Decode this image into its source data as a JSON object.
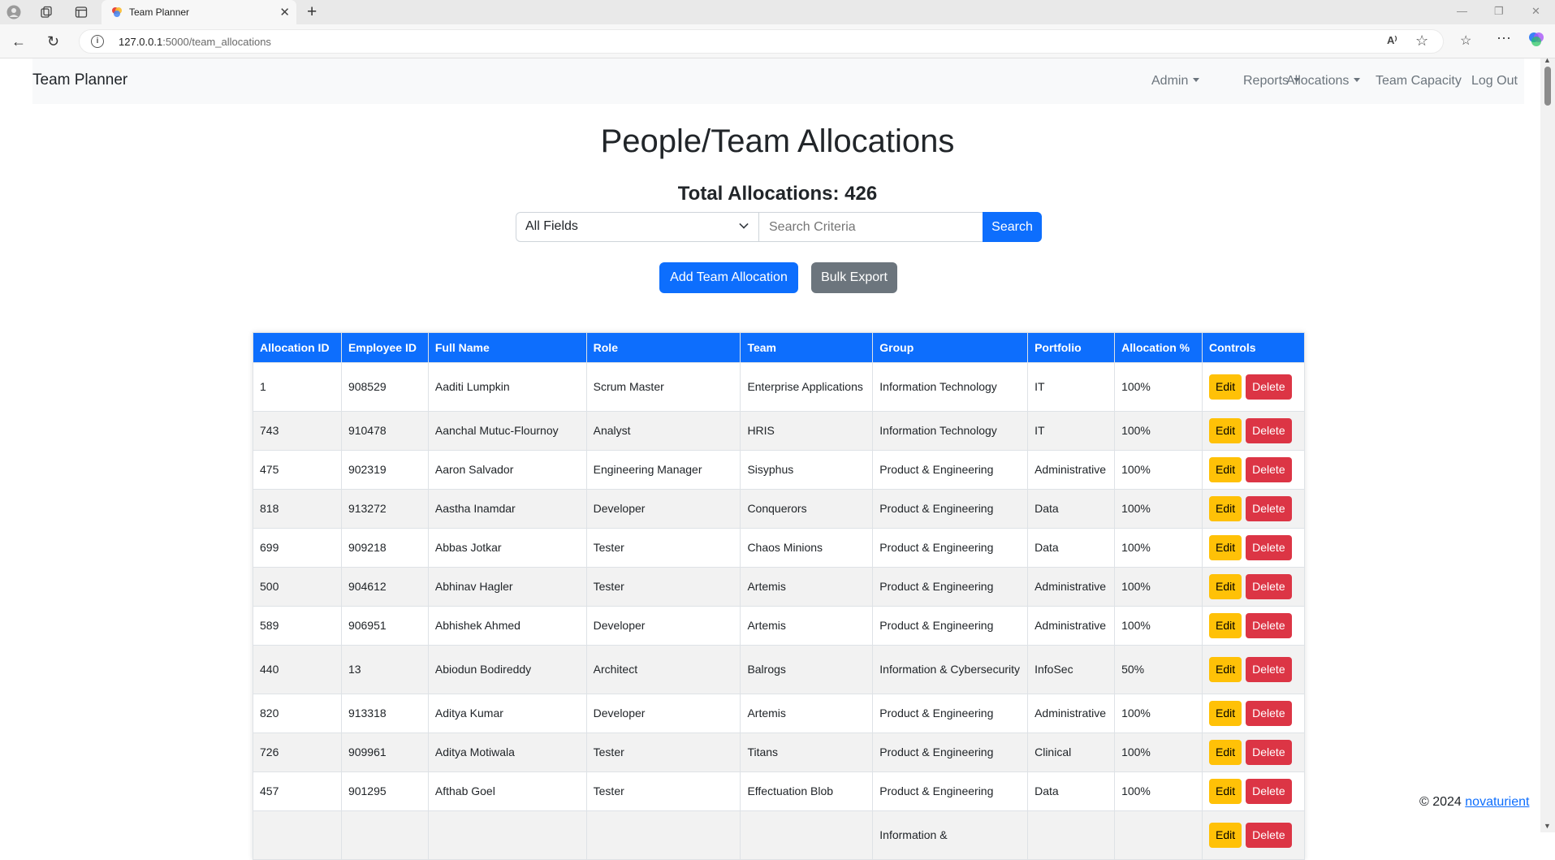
{
  "browser": {
    "tab_title": "Team Planner",
    "url_host": "127.0.0.1",
    "url_rest": ":5000/team_allocations"
  },
  "navbar": {
    "brand": "Team Planner",
    "items": [
      {
        "label": "Admin",
        "dropdown": true
      },
      {
        "label": "Reports",
        "dropdown": true
      },
      {
        "label": "Allocations",
        "dropdown": true
      },
      {
        "label": "Team Capacity",
        "dropdown": false
      },
      {
        "label": "Log Out",
        "dropdown": false
      }
    ]
  },
  "page": {
    "title": "People/Team Allocations",
    "total": "Total Allocations: 426"
  },
  "search": {
    "field_selected": "All Fields",
    "placeholder": "Search Criteria",
    "button": "Search"
  },
  "actions": {
    "add": "Add Team Allocation",
    "export": "Bulk Export"
  },
  "table": {
    "headers": [
      "Allocation ID",
      "Employee ID",
      "Full Name",
      "Role",
      "Team",
      "Group",
      "Portfolio",
      "Allocation %",
      "Controls"
    ],
    "edit_label": "Edit",
    "delete_label": "Delete",
    "rows": [
      [
        "1",
        "908529",
        "Aaditi Lumpkin",
        "Scrum Master",
        "Enterprise Applications",
        "Information Technology",
        "IT",
        "100%"
      ],
      [
        "743",
        "910478",
        "Aanchal Mutuc-Flournoy",
        "Analyst",
        "HRIS",
        "Information Technology",
        "IT",
        "100%"
      ],
      [
        "475",
        "902319",
        "Aaron Salvador",
        "Engineering Manager",
        "Sisyphus",
        "Product & Engineering",
        "Administrative",
        "100%"
      ],
      [
        "818",
        "913272",
        "Aastha Inamdar",
        "Developer",
        "Conquerors",
        "Product & Engineering",
        "Data",
        "100%"
      ],
      [
        "699",
        "909218",
        "Abbas Jotkar",
        "Tester",
        "Chaos Minions",
        "Product & Engineering",
        "Data",
        "100%"
      ],
      [
        "500",
        "904612",
        "Abhinav Hagler",
        "Tester",
        "Artemis",
        "Product & Engineering",
        "Administrative",
        "100%"
      ],
      [
        "589",
        "906951",
        "Abhishek Ahmed",
        "Developer",
        "Artemis",
        "Product & Engineering",
        "Administrative",
        "100%"
      ],
      [
        "440",
        "13",
        "Abiodun Bodireddy",
        "Architect",
        "Balrogs",
        "Information & Cybersecurity",
        "InfoSec",
        "50%"
      ],
      [
        "820",
        "913318",
        "Aditya Kumar",
        "Developer",
        "Artemis",
        "Product & Engineering",
        "Administrative",
        "100%"
      ],
      [
        "726",
        "909961",
        "Aditya Motiwala",
        "Tester",
        "Titans",
        "Product & Engineering",
        "Clinical",
        "100%"
      ],
      [
        "457",
        "901295",
        "Afthab Goel",
        "Tester",
        "Effectuation Blob",
        "Product & Engineering",
        "Data",
        "100%"
      ],
      [
        "",
        "",
        "",
        "",
        "",
        "Information &",
        "",
        ""
      ]
    ]
  },
  "footer": {
    "copyright": "© 2024 ",
    "link": "novaturient"
  }
}
